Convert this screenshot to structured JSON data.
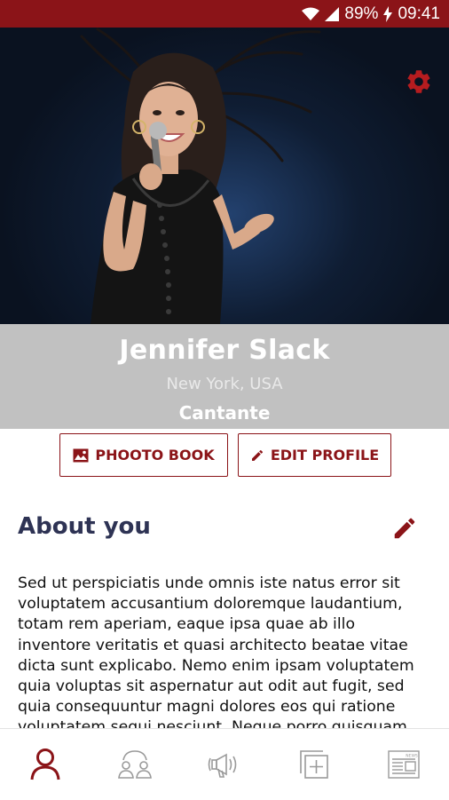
{
  "status_bar": {
    "battery": "89%",
    "time": "09:41"
  },
  "profile": {
    "name": "Jennifer Slack",
    "location": "New York, USA",
    "role": "Cantante"
  },
  "actions": {
    "photo_book_label": "PHOOTO BOOK",
    "edit_profile_label": "EDIT PROFILE"
  },
  "about": {
    "title": "About you",
    "text": "Sed ut perspiciatis unde omnis iste natus error sit voluptatem accusantium doloremque laudantium, totam rem aperiam, eaque ipsa quae ab illo inventore veritatis et quasi architecto beatae vitae dicta sunt explicabo. Nemo enim ipsam voluptatem quia voluptas sit aspernatur aut odit aut fugit, sed quia consequuntur magni dolores eos qui ratione voluptatem sequi nesciunt. Neque porro quisquam"
  },
  "bottom_nav": {
    "news_label": "NEWS"
  },
  "colors": {
    "accent": "#8b1418",
    "heading": "#2e3354",
    "band": "#c1c1c1",
    "nav_icon": "#9a9a9a"
  },
  "icons": [
    "wifi-icon",
    "signal-icon",
    "charging-icon",
    "gear-icon",
    "photo-icon",
    "pencil-icon",
    "profile-icon",
    "community-icon",
    "megaphone-icon",
    "add-post-icon",
    "news-icon"
  ]
}
